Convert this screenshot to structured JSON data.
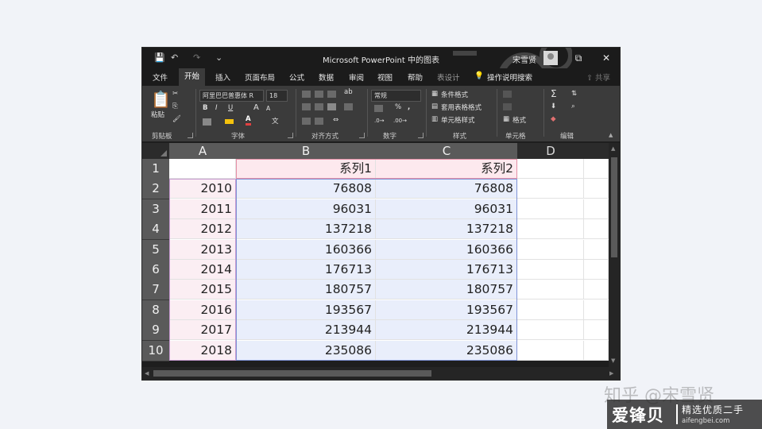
{
  "window": {
    "title": "Microsoft PowerPoint 中的图表",
    "user": "宋雪贤",
    "quick_access": [
      "💾",
      "↶",
      "↷",
      "⌄"
    ],
    "controls": [
      "⧉",
      "✕"
    ]
  },
  "tabs": [
    {
      "label": "文件"
    },
    {
      "label": "开始",
      "active": true
    },
    {
      "label": "插入"
    },
    {
      "label": "页面布局"
    },
    {
      "label": "公式"
    },
    {
      "label": "数据"
    },
    {
      "label": "审阅"
    },
    {
      "label": "视图"
    },
    {
      "label": "帮助"
    },
    {
      "label": "表设计"
    },
    {
      "label": "操作说明搜索"
    }
  ],
  "share_label": "共享",
  "ribbon": {
    "clipboard": {
      "paste": "粘贴",
      "label": "剪贴板"
    },
    "font": {
      "name": "阿里巴巴普惠体 R",
      "size": "18",
      "label": "字体",
      "bold": "B",
      "italic": "I",
      "underline": "U",
      "grow": "A",
      "shrink": "A",
      "color_a": "A"
    },
    "alignment": {
      "label": "对齐方式"
    },
    "number": {
      "format": "常规",
      "percent": "%",
      "comma": ",",
      "label": "数字"
    },
    "styles": {
      "conditional": "条件格式",
      "table": "套用表格格式",
      "cell": "单元格样式",
      "label": "样式"
    },
    "cells": {
      "format": "格式",
      "label": "单元格"
    },
    "editing": {
      "sum": "Σ",
      "label": "编辑"
    },
    "accent_colors": {
      "fill": "#f4c20d",
      "font": "#e04040"
    }
  },
  "sheet": {
    "columns": [
      "A",
      "B",
      "C",
      "D"
    ],
    "selected_columns": [
      "A",
      "B",
      "C"
    ],
    "rows": [
      "1",
      "2",
      "3",
      "4",
      "5",
      "6",
      "7",
      "8",
      "9",
      "10"
    ],
    "header_row": [
      "",
      "系列1",
      "系列2",
      ""
    ],
    "data": [
      [
        "2010",
        "76808",
        "76808"
      ],
      [
        "2011",
        "96031",
        "96031"
      ],
      [
        "2012",
        "137218",
        "137218"
      ],
      [
        "2013",
        "160366",
        "160366"
      ],
      [
        "2014",
        "176713",
        "176713"
      ],
      [
        "2015",
        "180757",
        "180757"
      ],
      [
        "2016",
        "193567",
        "193567"
      ],
      [
        "2017",
        "213944",
        "213944"
      ],
      [
        "2018",
        "235086",
        "235086"
      ]
    ],
    "range_colors": {
      "category": "#fbeef3",
      "series_header": "#fde9ee",
      "values": "#e9eefb"
    }
  },
  "watermark": {
    "zhihu": "知乎 @宋雪贤",
    "brand": "爱锋贝",
    "tagline": "精选优质二手",
    "url": "aifengbei.com"
  }
}
